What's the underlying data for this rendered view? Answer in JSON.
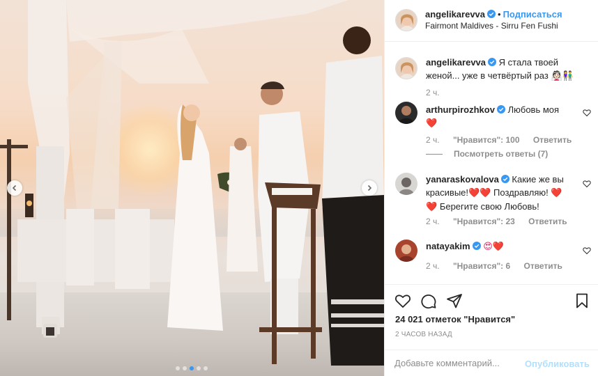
{
  "photo": {
    "carousel": {
      "slide_count": 5,
      "active_index": 2
    },
    "icons": {
      "prev": "chevron-left-icon",
      "next": "chevron-right-icon"
    }
  },
  "header": {
    "username": "angelikarevva",
    "separator": "•",
    "follow_label": "Подписаться",
    "location": "Fairmont Maldives - Sirru Fen Fushi"
  },
  "caption": {
    "username": "angelikarevva",
    "text": "Я стала твоей женой... уже в четвёртый раз",
    "emoji": "👰🏻👫",
    "time": "2 ч."
  },
  "comments": [
    {
      "username": "arthurpirozhkov",
      "verified": true,
      "text": "Любовь моя",
      "emoji": "❤️",
      "time": "2 ч.",
      "likes_label": "\"Нравится\": 100",
      "reply_label": "Ответить"
    },
    {
      "username": "yanaraskovalova",
      "verified": true,
      "text_line1": "Какие же вы",
      "text_line2": "красивые!",
      "text_line2b": "Поздравляю!",
      "text_line3": "Берегите свою Любовь!",
      "time": "2 ч.",
      "likes_label": "\"Нравится\": 23",
      "reply_label": "Ответить"
    },
    {
      "username": "natayakim",
      "verified": true,
      "emoji": "😍❤️",
      "time": "2 ч.",
      "likes_label": "\"Нравится\": 6",
      "reply_label": "Ответить"
    }
  ],
  "view_replies_label": "Посмотреть ответы (7)",
  "actions": {
    "icons": [
      "heart-icon",
      "comment-icon",
      "share-icon",
      "bookmark-icon"
    ]
  },
  "likes_text": "24 021 отметок \"Нравится\"",
  "timestamp": "2 ЧАСОВ НАЗАД",
  "add_comment": {
    "placeholder": "Добавьте комментарий...",
    "publish_label": "Опубликовать"
  },
  "colors": {
    "accent": "#3897f0",
    "muted": "#8e8e8e",
    "heart": "#e0245e",
    "publish_disabled": "#b2dffc"
  }
}
